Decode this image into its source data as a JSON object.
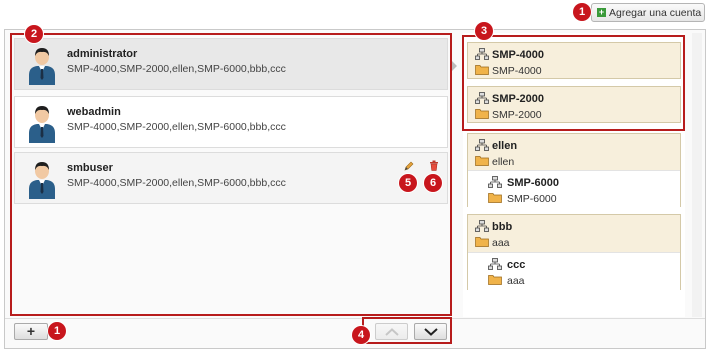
{
  "header": {
    "add_account_label": "Agregar una cuenta"
  },
  "users": [
    {
      "name": "administrator",
      "groups": "SMP-4000,SMP-2000,ellen,SMP-6000,bbb,ccc"
    },
    {
      "name": "webadmin",
      "groups": "SMP-4000,SMP-2000,ellen,SMP-6000,bbb,ccc"
    },
    {
      "name": "smbuser",
      "groups": "SMP-4000,SMP-2000,ellen,SMP-6000,bbb,ccc"
    }
  ],
  "groups": [
    {
      "name": "SMP-4000",
      "sub": "SMP-4000"
    },
    {
      "name": "SMP-2000",
      "sub": "SMP-2000"
    },
    {
      "name": "ellen",
      "sub": "ellen",
      "child": {
        "name": "SMP-6000",
        "sub": "SMP-6000"
      }
    },
    {
      "name": "bbb",
      "sub": "aaa",
      "child": {
        "name": "ccc",
        "sub": "aaa"
      }
    }
  ],
  "badges": {
    "b1": "1",
    "b2": "2",
    "b3": "3",
    "b4": "4",
    "b5": "5",
    "b6": "6",
    "b1_bottom": "1"
  },
  "bottom": {
    "add_label": "+"
  },
  "colors": {
    "callout": "#c8161d",
    "group_bg": "#f7efdc",
    "selected_row": "#e8e8e8"
  },
  "icons": {
    "user": "user-avatar-icon",
    "network": "network-icon",
    "folder": "folder-icon",
    "edit": "pencil-icon",
    "delete": "trash-icon",
    "up": "chevron-up-icon",
    "down": "chevron-down-icon"
  }
}
